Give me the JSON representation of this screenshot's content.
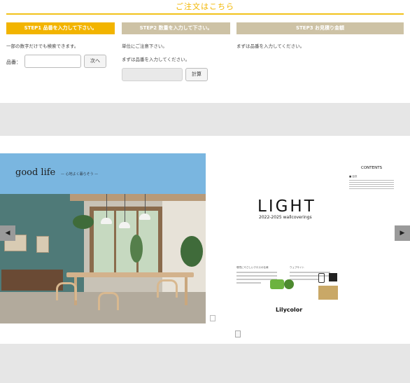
{
  "order": {
    "title": "ご注文はこちら"
  },
  "steps": [
    {
      "label": "STEP1 品番を入力して下さい。",
      "color": "#f2b400"
    },
    {
      "label": "STEP2 数量を入力して下さい。",
      "color": "#cdc2a5"
    },
    {
      "label": "STEP3 お見積り金額",
      "color": "#cdc2a5"
    }
  ],
  "step1": {
    "note": "一部の数字だけでも検索できます。",
    "field_label": "品番：",
    "input_value": "",
    "next_button": "次へ"
  },
  "step2": {
    "note_unit": "単位にご注意下さい。",
    "note_enter": "まずは品番を入力してください。",
    "quantity_value": "",
    "calc_button": "計算"
  },
  "step3": {
    "note": "まずは品番を入力してください。"
  },
  "catalog": {
    "left_title": "good life",
    "left_subtitle": "— 心地よく暮らそう —",
    "main_title": "LIGHT",
    "main_subtitle": "2022-2025  wallcoverings",
    "brand": "Lilycolor",
    "contents_title": "CONTENTS",
    "prev_arrow": "◀",
    "next_arrow": "▶",
    "info_col1_title": "環境にやさしいクロスの仕様",
    "info_col2_title": "ウェブサイト",
    "toc": [
      {
        "label": "■ 目次",
        "page": ""
      },
      {
        "label": "",
        "page": ""
      },
      {
        "label": "",
        "page": ""
      },
      {
        "label": "",
        "page": ""
      },
      {
        "label": "",
        "page": ""
      },
      {
        "label": "",
        "page": ""
      },
      {
        "label": "",
        "page": ""
      },
      {
        "label": "",
        "page": ""
      },
      {
        "label": "",
        "page": ""
      },
      {
        "label": "",
        "page": ""
      },
      {
        "label": "",
        "page": ""
      },
      {
        "label": "",
        "page": ""
      },
      {
        "label": "",
        "page": ""
      },
      {
        "label": "",
        "page": ""
      },
      {
        "label": "",
        "page": ""
      },
      {
        "label": "",
        "page": ""
      },
      {
        "label": "",
        "page": ""
      },
      {
        "label": "",
        "page": ""
      },
      {
        "label": "",
        "page": ""
      },
      {
        "label": "",
        "page": ""
      },
      {
        "label": "",
        "page": ""
      },
      {
        "label": "",
        "page": ""
      },
      {
        "label": "",
        "page": ""
      },
      {
        "label": "",
        "page": ""
      },
      {
        "label": "",
        "page": ""
      },
      {
        "label": "",
        "page": ""
      },
      {
        "label": "",
        "page": ""
      },
      {
        "label": "",
        "page": ""
      },
      {
        "label": "",
        "page": ""
      },
      {
        "label": "",
        "page": ""
      },
      {
        "label": "",
        "page": ""
      },
      {
        "label": "",
        "page": ""
      },
      {
        "label": "",
        "page": ""
      },
      {
        "label": "",
        "page": ""
      },
      {
        "label": "",
        "page": ""
      },
      {
        "label": "",
        "page": ""
      },
      {
        "label": "",
        "page": ""
      }
    ]
  }
}
